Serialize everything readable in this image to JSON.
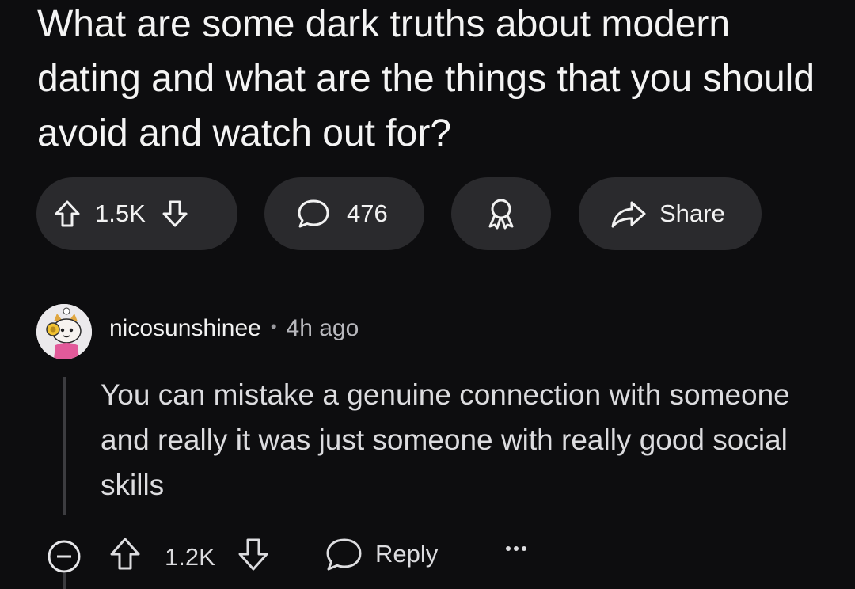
{
  "post": {
    "title": "What are some dark truths about modern dating and what are the things that you should avoid and watch out for?"
  },
  "actions": {
    "vote_count": "1.5K",
    "comment_count": "476",
    "share_label": "Share"
  },
  "comment": {
    "author": "nicosunshinee",
    "separator": "•",
    "age": "4h ago",
    "body": "You can mistake a genuine connection with someone and really it was just someone with really good social skills",
    "vote_count": "1.2K",
    "reply_label": "Reply"
  },
  "icons": {
    "upvote": "upvote-arrow-icon",
    "downvote": "downvote-arrow-icon",
    "comment": "comment-bubble-icon",
    "award": "award-ribbon-icon",
    "share": "share-arrow-icon",
    "collapse": "collapse-minus-icon",
    "more": "more-dots-icon"
  },
  "colors": {
    "background": "#0d0d0f",
    "pill": "#2a2a2d",
    "text": "#f2f2f2",
    "muted": "#b8b8bd"
  }
}
